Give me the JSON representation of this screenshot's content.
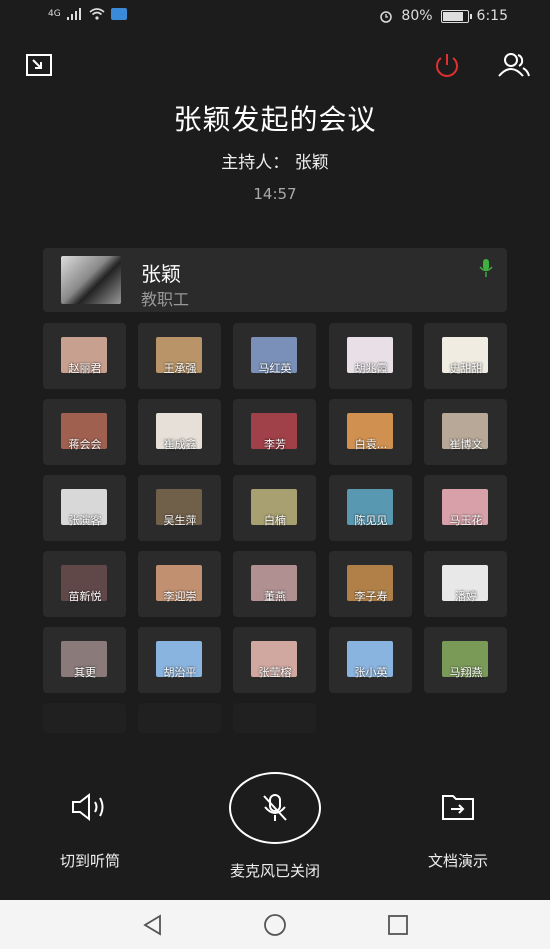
{
  "status_bar": {
    "network": "4G",
    "battery": "80%",
    "time": "6:15"
  },
  "meeting": {
    "title": "张颖发起的会议",
    "host_label": "主持人： 张颖",
    "duration": "14:57"
  },
  "host_card": {
    "name": "张颖",
    "role": "教职工"
  },
  "participants": [
    {
      "name": "赵丽君",
      "color": "#c8a090"
    },
    {
      "name": "王承强",
      "color": "#b89468"
    },
    {
      "name": "马红英",
      "color": "#7a90b8"
    },
    {
      "name": "胡兆霞",
      "color": "#e8e0e6"
    },
    {
      "name": "史甜甜",
      "color": "#f0ece2"
    },
    {
      "name": "蒋会会",
      "color": "#a06050"
    },
    {
      "name": "崔成鑫",
      "color": "#e6e0d8"
    },
    {
      "name": "李芳",
      "color": "#a04048"
    },
    {
      "name": "白袁...",
      "color": "#d09050"
    },
    {
      "name": "崔博文",
      "color": "#b8a898"
    },
    {
      "name": "张演客",
      "color": "#d8d8d8"
    },
    {
      "name": "吴生萍",
      "color": "#70604a"
    },
    {
      "name": "白楠",
      "color": "#a8a070"
    },
    {
      "name": "陈见见",
      "color": "#5898b0"
    },
    {
      "name": "马玉花",
      "color": "#d8a0a8"
    },
    {
      "name": "苗新悦",
      "color": "#604848"
    },
    {
      "name": "李迎崇",
      "color": "#c09070"
    },
    {
      "name": "董燕",
      "color": "#b09090"
    },
    {
      "name": "李子寿",
      "color": "#b08048"
    },
    {
      "name": "潘婷",
      "color": "#e8e8e8"
    },
    {
      "name": "其更",
      "color": "#8a7a7a"
    },
    {
      "name": "胡治平",
      "color": "#8ab4e0"
    },
    {
      "name": "张莹榕",
      "color": "#d0a8a0"
    },
    {
      "name": "张小英",
      "color": "#8ab4e0"
    },
    {
      "name": "马翔燕",
      "color": "#7a9a58"
    }
  ],
  "controls": {
    "speaker_label": "切到听筒",
    "mic_label": "麦克风已关闭",
    "share_label": "文档演示"
  },
  "colors": {
    "background": "#1c1c1c",
    "tile": "#2b2b2b",
    "power_red": "#e03030",
    "mic_green": "#40b040"
  }
}
